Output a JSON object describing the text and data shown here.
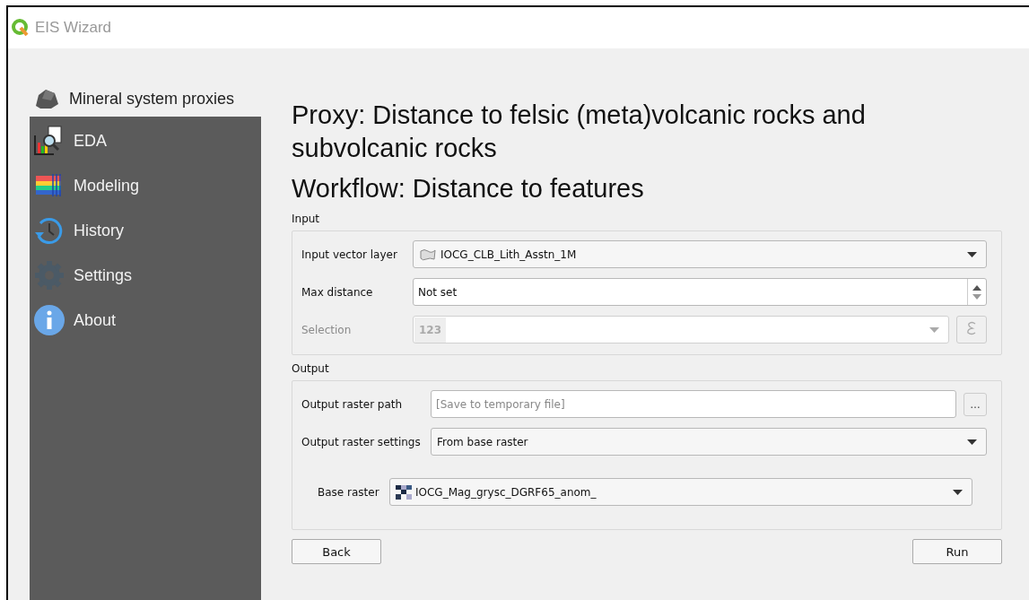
{
  "window": {
    "title": "EIS Wizard"
  },
  "nav_header": {
    "label": "Mineral system proxies"
  },
  "sidebar": {
    "items": [
      {
        "label": "EDA",
        "kind": "eda"
      },
      {
        "label": "Modeling",
        "kind": "modeling"
      },
      {
        "label": "History",
        "kind": "history"
      },
      {
        "label": "Settings",
        "kind": "settings"
      },
      {
        "label": "About",
        "kind": "about"
      }
    ]
  },
  "proxy_title": "Proxy: Distance to felsic (meta)volcanic rocks and subvolcanic rocks",
  "workflow_title": "Workflow: Distance to features",
  "input": {
    "title": "Input",
    "fields": [
      {
        "label": "Input vector layer",
        "kind": "layer-combo",
        "value": "IOCG_CLB_Lith_Asstn_1M",
        "disabled": false
      },
      {
        "label": "Max distance",
        "kind": "spin",
        "value": "Not set",
        "disabled": false
      },
      {
        "label": "Selection",
        "kind": "expression",
        "value": "123",
        "disabled": true
      }
    ]
  },
  "output": {
    "title": "Output",
    "fields": [
      {
        "label": "Output raster path",
        "kind": "file",
        "placeholder": "[Save to temporary file]",
        "button": "…",
        "disabled": false
      },
      {
        "label": "Output raster settings",
        "kind": "combo",
        "value": "From base raster",
        "disabled": false
      },
      {
        "label": "Base raster",
        "kind": "raster-combo",
        "value": "IOCG_Mag_grysc_DGRF65_anom_",
        "disabled": false
      }
    ]
  },
  "buttons": {
    "back": "Back",
    "run": "Run"
  }
}
